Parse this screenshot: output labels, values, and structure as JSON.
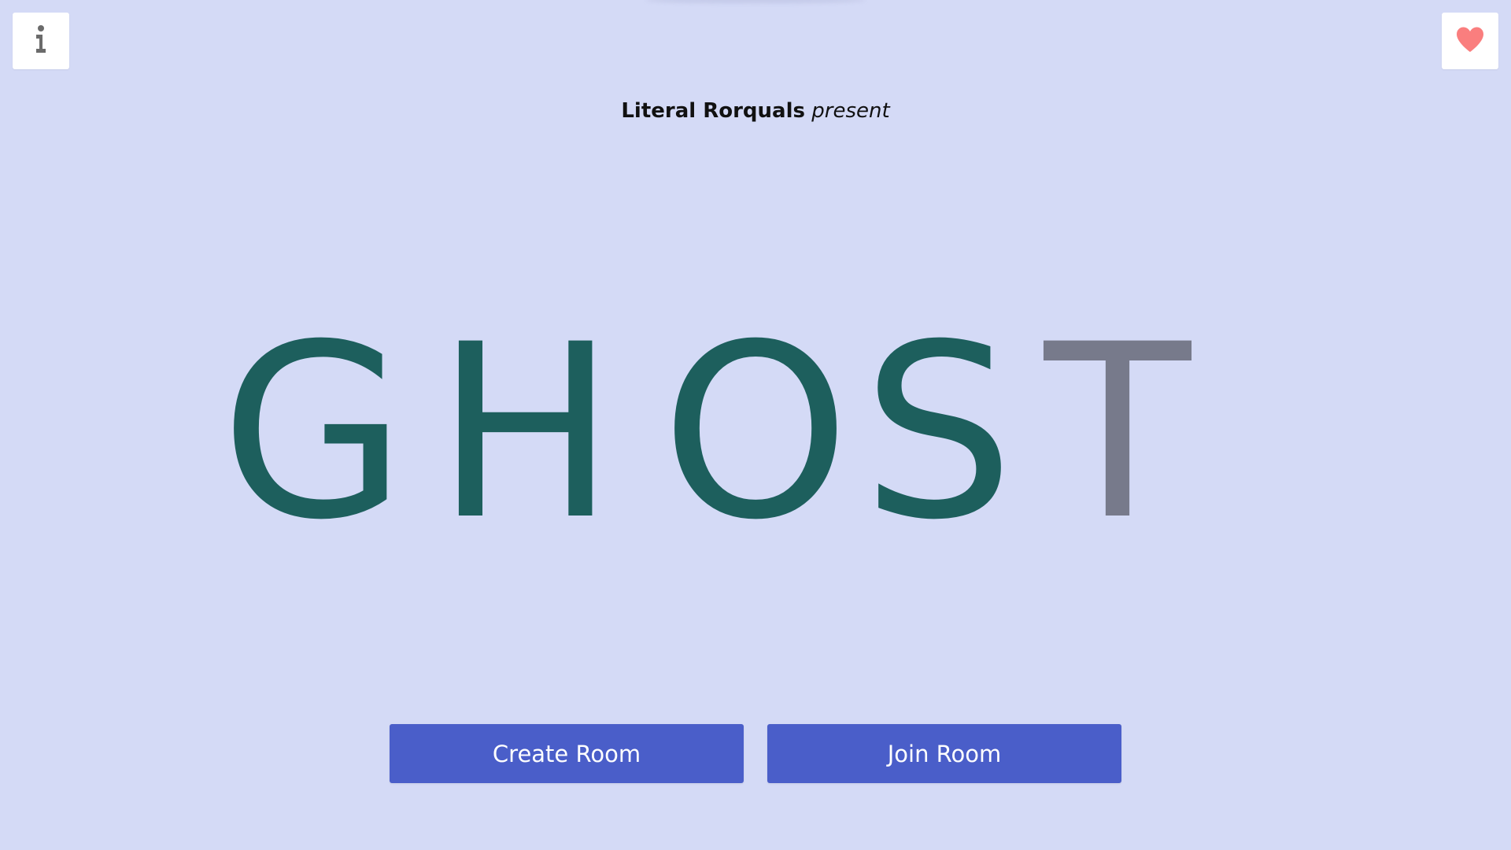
{
  "header": {
    "info_icon": "info-icon",
    "heart_icon": "heart-icon",
    "heart_color": "#fa7e7e",
    "info_color": "#6b6b6b"
  },
  "credit": {
    "studio": "Literal Rorquals",
    "verb": "present"
  },
  "title": {
    "letters": [
      {
        "char": "G",
        "color": "#1d5f5d",
        "revealed": true
      },
      {
        "char": "H",
        "color": "#1d5f5d",
        "revealed": true
      },
      {
        "char": "O",
        "color": "#1d5f5d",
        "revealed": true
      },
      {
        "char": "S",
        "color": "#1d5f5d",
        "revealed": true
      },
      {
        "char": "T",
        "color": "#777a8b",
        "revealed": false
      }
    ]
  },
  "actions": {
    "create_label": "Create Room",
    "join_label": "Join Room",
    "button_color": "#4a5ec9"
  },
  "theme": {
    "background": "#d4daf6"
  }
}
